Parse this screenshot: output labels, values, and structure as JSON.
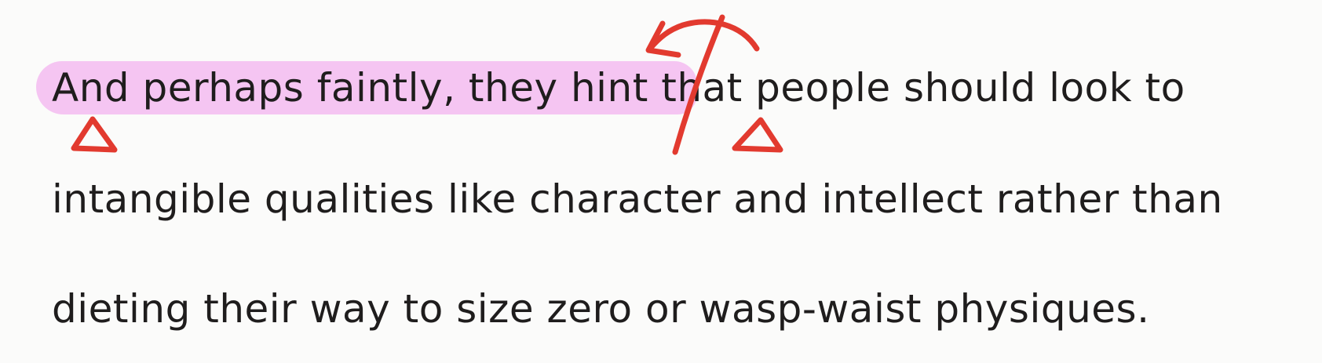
{
  "text": {
    "line1_highlighted": "And perhaps faintly, they hint",
    "line1_rest": " that people should look to",
    "line2": "intangible qualities like character and intellect rather than",
    "line3": "dieting their way to size zero or wasp-waist physiques."
  },
  "colors": {
    "text": "#1f1d1d",
    "highlight": "#f4b6ef",
    "annotation": "#e23a2f",
    "background": "#fbfbfa"
  },
  "annotations": [
    "highlight-stroke",
    "insertion-caret-left",
    "insertion-caret-right",
    "swap-arrow"
  ]
}
